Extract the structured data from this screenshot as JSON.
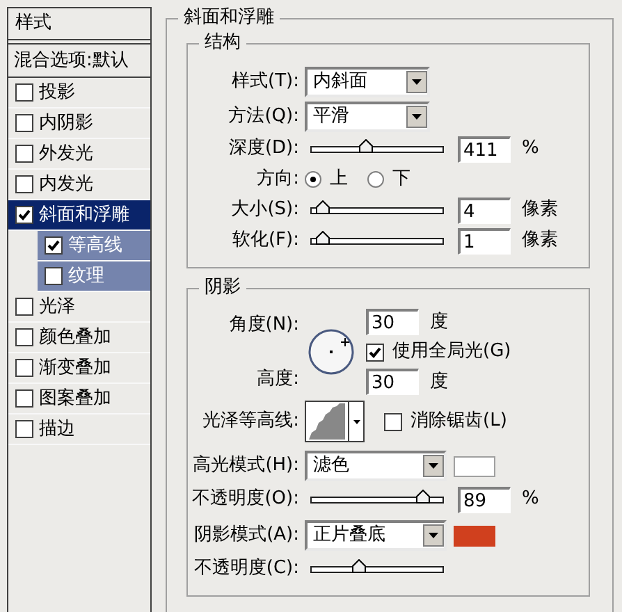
{
  "sidebar": {
    "header": "样式",
    "blend_options": "混合选项:默认",
    "items": [
      {
        "label": "投影",
        "checked": false,
        "selected": false
      },
      {
        "label": "内阴影",
        "checked": false,
        "selected": false
      },
      {
        "label": "外发光",
        "checked": false,
        "selected": false
      },
      {
        "label": "内发光",
        "checked": false,
        "selected": false
      },
      {
        "label": "斜面和浮雕",
        "checked": true,
        "selected": true,
        "children": [
          {
            "label": "等高线",
            "checked": true,
            "selected": false
          },
          {
            "label": "纹理",
            "checked": false,
            "selected": false
          }
        ]
      },
      {
        "label": "光泽",
        "checked": false,
        "selected": false
      },
      {
        "label": "颜色叠加",
        "checked": false,
        "selected": false
      },
      {
        "label": "渐变叠加",
        "checked": false,
        "selected": false
      },
      {
        "label": "图案叠加",
        "checked": false,
        "selected": false
      },
      {
        "label": "描边",
        "checked": false,
        "selected": false
      }
    ]
  },
  "panel": {
    "title": "斜面和浮雕",
    "structure": {
      "title": "结构",
      "style": {
        "label": "样式(T):",
        "value": "内斜面"
      },
      "technique": {
        "label": "方法(Q):",
        "value": "平滑"
      },
      "depth": {
        "label": "深度(D):",
        "level": 0.41,
        "value": "411",
        "unit": "%"
      },
      "direction": {
        "label": "方向:",
        "options": [
          {
            "label": "上",
            "selected": true
          },
          {
            "label": "下",
            "selected": false
          }
        ]
      },
      "size": {
        "label": "大小(S):",
        "level": 0.03,
        "value": "4",
        "unit": "像素"
      },
      "soften": {
        "label": "软化(F):",
        "level": 0.03,
        "value": "1",
        "unit": "像素"
      }
    },
    "shading": {
      "title": "阴影",
      "angle": {
        "label": "角度(N):",
        "value": "30",
        "unit": "度"
      },
      "global_light": {
        "label": "使用全局光(G)",
        "checked": true
      },
      "altitude": {
        "label": "高度:",
        "value": "30",
        "unit": "度"
      },
      "gloss_contour": {
        "label": "光泽等高线:"
      },
      "anti_aliased": {
        "label": "消除锯齿(L)",
        "checked": false
      },
      "highlight_mode": {
        "label": "高光模式(H):",
        "value": "滤色",
        "color": "#ffffff"
      },
      "highlight_opacity": {
        "label": "不透明度(O):",
        "level": 0.89,
        "value": "89",
        "unit": "%"
      },
      "shadow_mode": {
        "label": "阴影模式(A):",
        "value": "正片叠底",
        "color": "#d0401e"
      },
      "shadow_opacity": {
        "label": "不透明度(C):",
        "level": 0.35
      }
    }
  }
}
